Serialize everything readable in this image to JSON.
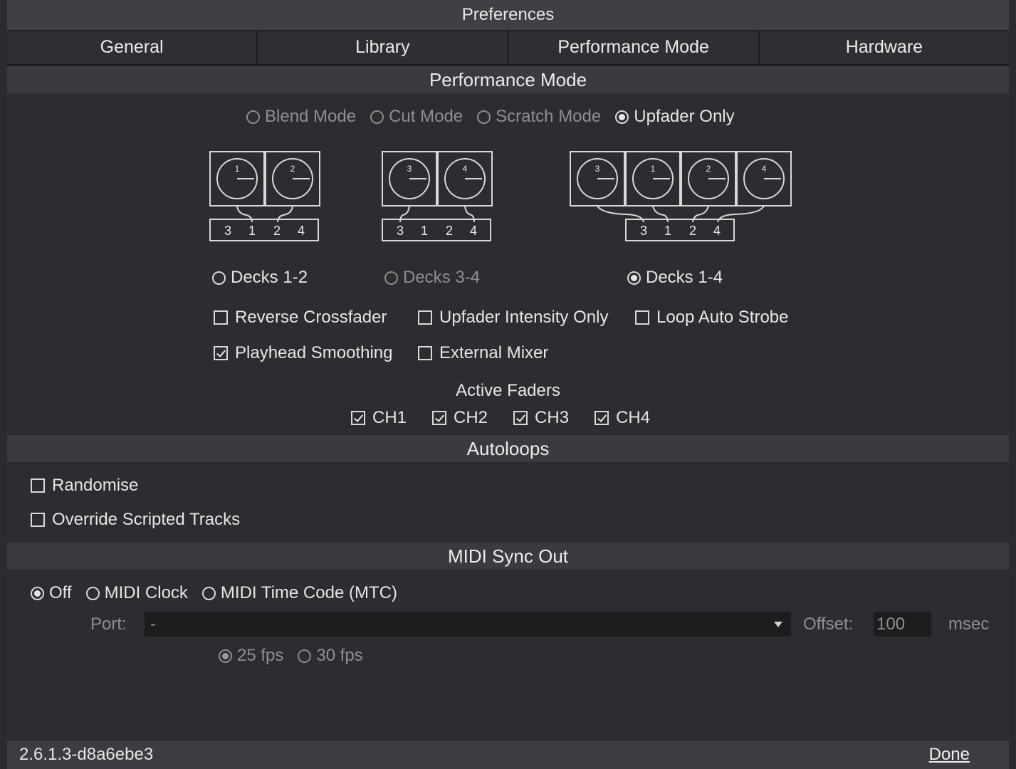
{
  "window": {
    "title": "Preferences"
  },
  "tabs": [
    {
      "label": "General"
    },
    {
      "label": "Library"
    },
    {
      "label": "Performance Mode"
    },
    {
      "label": "Hardware"
    }
  ],
  "performance_mode": {
    "header": "Performance Mode",
    "modes": [
      {
        "label": "Blend Mode",
        "selected": false,
        "enabled": false
      },
      {
        "label": "Cut Mode",
        "selected": false,
        "enabled": false
      },
      {
        "label": "Scratch Mode",
        "selected": false,
        "enabled": false
      },
      {
        "label": "Upfader Only",
        "selected": true,
        "enabled": true
      }
    ],
    "deck_layouts": [
      {
        "label": "Decks 1-2",
        "decks": [
          "1",
          "2"
        ],
        "channels": [
          "3",
          "1",
          "2",
          "4"
        ],
        "selected": false,
        "enabled": true
      },
      {
        "label": "Decks 3-4",
        "decks": [
          "3",
          "4"
        ],
        "channels": [
          "3",
          "1",
          "2",
          "4"
        ],
        "selected": false,
        "enabled": false
      },
      {
        "label": "Decks 1-4",
        "decks": [
          "3",
          "1",
          "2",
          "4"
        ],
        "channels": [
          "3",
          "1",
          "2",
          "4"
        ],
        "selected": true,
        "enabled": true
      }
    ],
    "options": [
      {
        "label": "Reverse Crossfader",
        "checked": false
      },
      {
        "label": "Upfader Intensity Only",
        "checked": false
      },
      {
        "label": "Loop Auto Strobe",
        "checked": false
      },
      {
        "label": "Playhead Smoothing",
        "checked": true
      },
      {
        "label": "External Mixer",
        "checked": false
      }
    ],
    "active_faders": {
      "title": "Active Faders",
      "channels": [
        {
          "label": "CH1",
          "checked": true
        },
        {
          "label": "CH2",
          "checked": true
        },
        {
          "label": "CH3",
          "checked": true
        },
        {
          "label": "CH4",
          "checked": true
        }
      ]
    }
  },
  "autoloops": {
    "header": "Autoloops",
    "options": [
      {
        "label": "Randomise",
        "checked": false
      },
      {
        "label": "Override Scripted Tracks",
        "checked": false
      }
    ]
  },
  "midi_sync_out": {
    "header": "MIDI Sync Out",
    "modes": [
      {
        "label": "Off",
        "selected": true
      },
      {
        "label": "MIDI Clock",
        "selected": false
      },
      {
        "label": "MIDI Time Code (MTC)",
        "selected": false
      }
    ],
    "port_label": "Port:",
    "port_value": "-",
    "offset_label": "Offset:",
    "offset_value": "100",
    "offset_unit": "msec",
    "fps": [
      {
        "label": "25 fps",
        "selected": true
      },
      {
        "label": "30 fps",
        "selected": false
      }
    ]
  },
  "footer": {
    "version": "2.6.1.3-d8a6ebe3",
    "done_label": "Done"
  }
}
